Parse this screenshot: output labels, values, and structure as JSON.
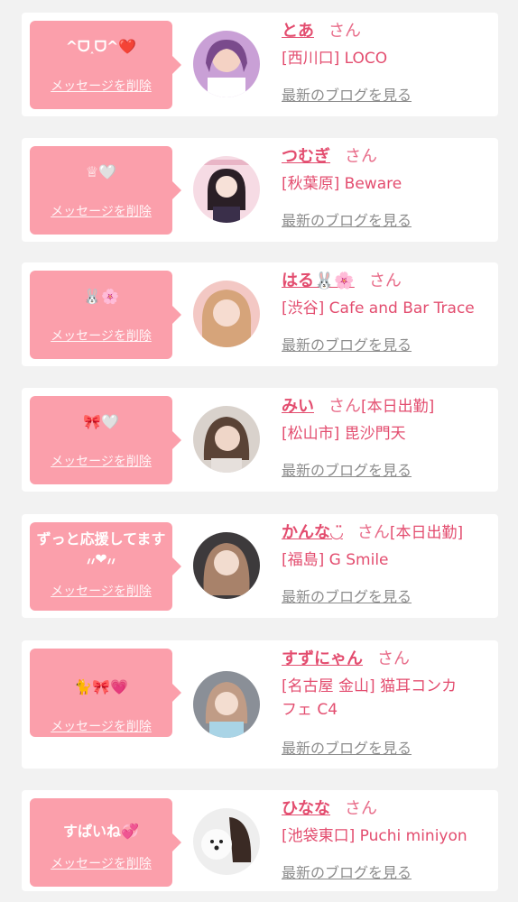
{
  "delete_label": "メッセージを削除",
  "blog_label": "最新のブログを見る",
  "honorific": "さん",
  "colors": {
    "bubble": "#fb9fab",
    "name": "#e34d6f",
    "link_gray": "#8c8c8c",
    "background": "#f2f2f2"
  },
  "cards": [
    {
      "message": "^ᗜ˰ᗜ^❤️",
      "name": "とあ",
      "status": "",
      "shop": "[西川口] LOCO",
      "shop_line2": ""
    },
    {
      "message": "♕🤍",
      "name": "つむぎ",
      "status": "",
      "shop": "[秋葉原] Beware",
      "shop_line2": ""
    },
    {
      "message": "🐰🌸",
      "name": "はる🐰🌸",
      "status": "",
      "shop": "[渋谷] Cafe and Bar Trace",
      "shop_line2": ""
    },
    {
      "message": "🎀🤍",
      "name": "みい",
      "status": "[本日出勤]",
      "shop": "[松山市] 毘沙門天",
      "shop_line2": ""
    },
    {
      "message": "ずっと応援してます ៸៸❤︎៸៸",
      "name": "かんな◡̈",
      "status": "[本日出勤]",
      "shop": "[福島] G Smile",
      "shop_line2": ""
    },
    {
      "message": "🐈🎀💗",
      "name": "すずにゃん",
      "status": "",
      "shop": "[名古屋 金山] 猫耳コンカ",
      "shop_line2": "フェ C4"
    },
    {
      "message": "すぱいね💞",
      "name": "ひなな",
      "status": "",
      "shop": "[池袋東口] Puchi miniyon",
      "shop_line2": ""
    }
  ]
}
